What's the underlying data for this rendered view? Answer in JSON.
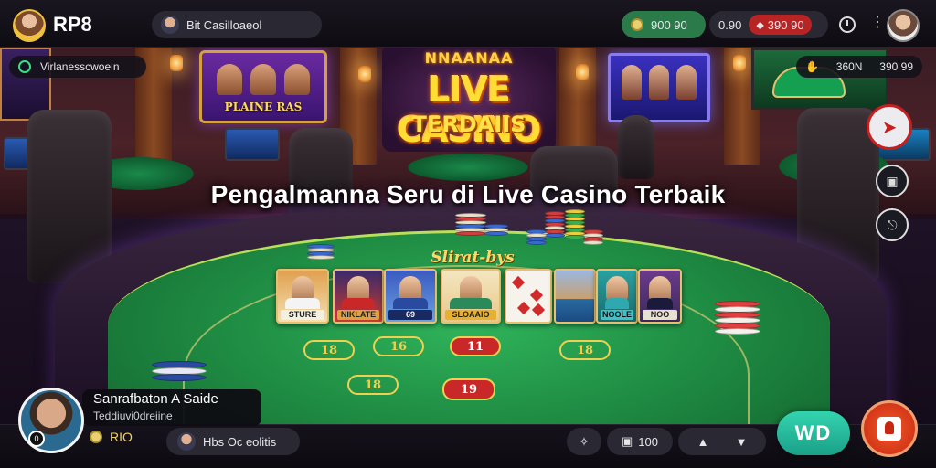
{
  "header": {
    "brand": "RP8",
    "room_label": "Bit Casilloaeol",
    "balance": "900 90",
    "bet_label": "0.90",
    "bet_amount": "390 90"
  },
  "status": {
    "left_label": "Virlanesscwoein",
    "right_amount": "360N",
    "right_value": "390 99"
  },
  "signage": {
    "poster_text": "PLAINE RAS",
    "marquee_top": "NNAANAA",
    "marquee_main": "LIVE CASINO",
    "marquee_sub": "TERDAIIS"
  },
  "headline": "Pengalmanna Seru  di Live Casino Terbaik",
  "board": {
    "title": "Slirat-bys",
    "cards": [
      {
        "caption": "STURE"
      },
      {
        "caption": "NIKLATE"
      },
      {
        "caption": "69"
      },
      {
        "caption": "SLOAAIO"
      },
      {
        "caption": ""
      },
      {
        "caption": ""
      },
      {
        "caption": "NOOLE"
      },
      {
        "caption": "NOO"
      }
    ],
    "numbers": [
      "18",
      "16",
      "11",
      "18",
      "19"
    ]
  },
  "dealer": {
    "name": "Sanrafbaton A Saide",
    "subtitle": "Teddiuvi0dreiine",
    "badge": "0",
    "coins": "RIO"
  },
  "bottom": {
    "player_label": "Hbs Oc eolitis",
    "count": "100",
    "win_label": "WD"
  },
  "icons": {
    "timer": "clock-icon",
    "menu": "more-icon",
    "rocket": "rocket-icon",
    "save": "save-icon",
    "share": "share-icon",
    "gamepad": "gamepad-icon",
    "chat": "chat-icon"
  },
  "colors": {
    "felt": "#1e8a42",
    "accent_red": "#c82828",
    "win_teal": "#1aa088",
    "gold": "#f0d050"
  }
}
